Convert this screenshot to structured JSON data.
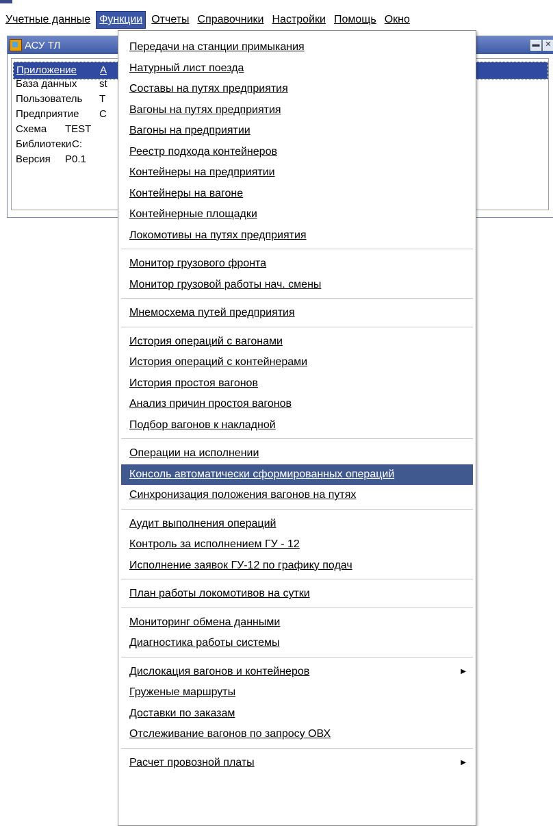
{
  "menubar": {
    "items": [
      "Учетные данные",
      "Функции",
      "Отчеты",
      "Справочники",
      "Настройки",
      "Помощь",
      "Окно"
    ],
    "active_index": 1
  },
  "window": {
    "title": "АСУ ТЛ",
    "rows": [
      {
        "key": "Приложение",
        "value": "А"
      },
      {
        "key": "База данных",
        "value": "st"
      },
      {
        "key": "Пользователь",
        "value": "T"
      },
      {
        "key": "Предприятие",
        "value": "С"
      },
      {
        "key": "Схема",
        "value": "TEST"
      },
      {
        "key": "Библиотеки",
        "value": "C:"
      },
      {
        "key": "Версия",
        "value": "P0.1"
      }
    ]
  },
  "dropdown": {
    "groups": [
      [
        "Передачи на станции примыкания",
        "Натурный лист поезда",
        "Составы на путях предприятия",
        "Вагоны на путях предприятия",
        "Вагоны на предприятии",
        "Реестр подхода контейнеров",
        "Контейнеры на предприятии",
        "Контейнеры на вагоне",
        "Контейнерные площадки",
        "Локомотивы на путях предприятия"
      ],
      [
        "Монитор грузового фронта",
        "Монитор грузовой работы нач. смены"
      ],
      [
        "Мнемосхема путей предприятия"
      ],
      [
        "История операций с вагонами",
        "История операций с контейнерами",
        "История простоя вагонов",
        "Анализ причин простоя вагонов",
        "Подбор вагонов к накладной"
      ],
      [
        "Операции на исполнении",
        "Консоль автоматически сформированных операций",
        "Синхронизация положения вагонов на путях"
      ],
      [
        "Аудит выполнения операций",
        "Контроль за исполнением ГУ - 12",
        "Исполнение заявок ГУ-12 по графику подач"
      ],
      [
        "План работы локомотивов на сутки"
      ],
      [
        "Мониторинг обмена данными",
        "Диагностика работы системы"
      ],
      [
        "Дислокация вагонов и контейнеров",
        "Груженые маршруты",
        "Доставки по заказам",
        "Отслеживание вагонов по запросу ОВХ"
      ],
      [
        "Расчет провозной платы"
      ]
    ],
    "selected": "Консоль автоматически сформированных операций",
    "submenu_items": [
      "Дислокация вагонов и контейнеров",
      "Расчет провозной платы"
    ],
    "submenu_arrow": "▶"
  }
}
